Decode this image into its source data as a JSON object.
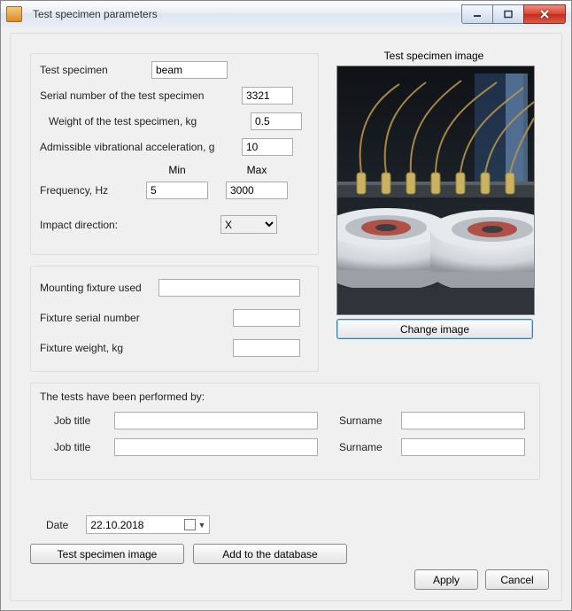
{
  "window": {
    "title": "Test specimen parameters"
  },
  "specimen": {
    "label_name": "Test specimen",
    "name": "beam",
    "label_serial": "Serial number of the test specimen",
    "serial": "3321",
    "label_weight": "Weight of the test specimen, kg",
    "weight": "0.5",
    "label_accel": "Admissible vibrational acceleration, g",
    "accel": "10",
    "label_freq": "Frequency, Hz",
    "label_min": "Min",
    "label_max": "Max",
    "freq_min": "5",
    "freq_max": "3000",
    "label_impact": "Impact direction:",
    "impact_value": "X"
  },
  "fixture": {
    "label_used": "Mounting fixture used",
    "used": "",
    "label_serial": "Fixture serial number",
    "serial": "",
    "label_weight": "Fixture weight, kg",
    "weight": ""
  },
  "image_panel": {
    "caption": "Test specimen image",
    "change_btn": "Change image"
  },
  "performed": {
    "heading": "The tests have been performed by:",
    "label_job": "Job title",
    "label_surname": "Surname",
    "rows": [
      {
        "job": "",
        "surname": ""
      },
      {
        "job": "",
        "surname": ""
      }
    ]
  },
  "date": {
    "label": "Date",
    "value": "22.10.2018"
  },
  "buttons": {
    "specimen_image": "Test specimen image",
    "add_db": "Add to the database",
    "apply": "Apply",
    "cancel": "Cancel"
  }
}
